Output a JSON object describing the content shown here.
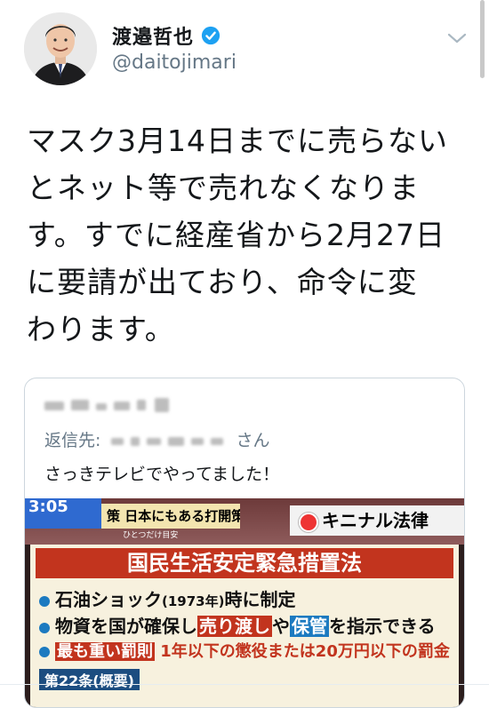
{
  "header": {
    "display_name": "渡邉哲也",
    "handle": "@daitojimari"
  },
  "tweet": {
    "text": "マスク3月14日までに売らない\nとネット等で売れなくなりま\nす。すでに経産省から2月27日\nに要請が出ており、命令に変\nわります。"
  },
  "quoted": {
    "reply_prefix": "返信先:",
    "reply_suffix": "さん",
    "text": "さっきテレビでやってました！",
    "tv": {
      "clock": "3:05",
      "ribbon": "策 日本にもある打開策…でも",
      "ribbon_sub": "ひとつだけ目安",
      "logo": "キニナル法律",
      "title": "国民生活安定緊急措置法",
      "line1_a": "石油ショック",
      "line1_b": "(1973年)",
      "line1_c": "時に制定",
      "line2_a": "物資を国が確保し",
      "line2_b": "売り渡し",
      "line2_c": "や",
      "line2_d": "保管",
      "line2_e": "を指示できる",
      "line3_a": "最も重い罰則",
      "line3_b": "1年以下の懲役または20万円以下の罰金",
      "article": "第22条(概要)"
    }
  },
  "colors": {
    "verified": "#1da1f2",
    "secondary_text": "#657786",
    "border": "#ccd6dd"
  }
}
